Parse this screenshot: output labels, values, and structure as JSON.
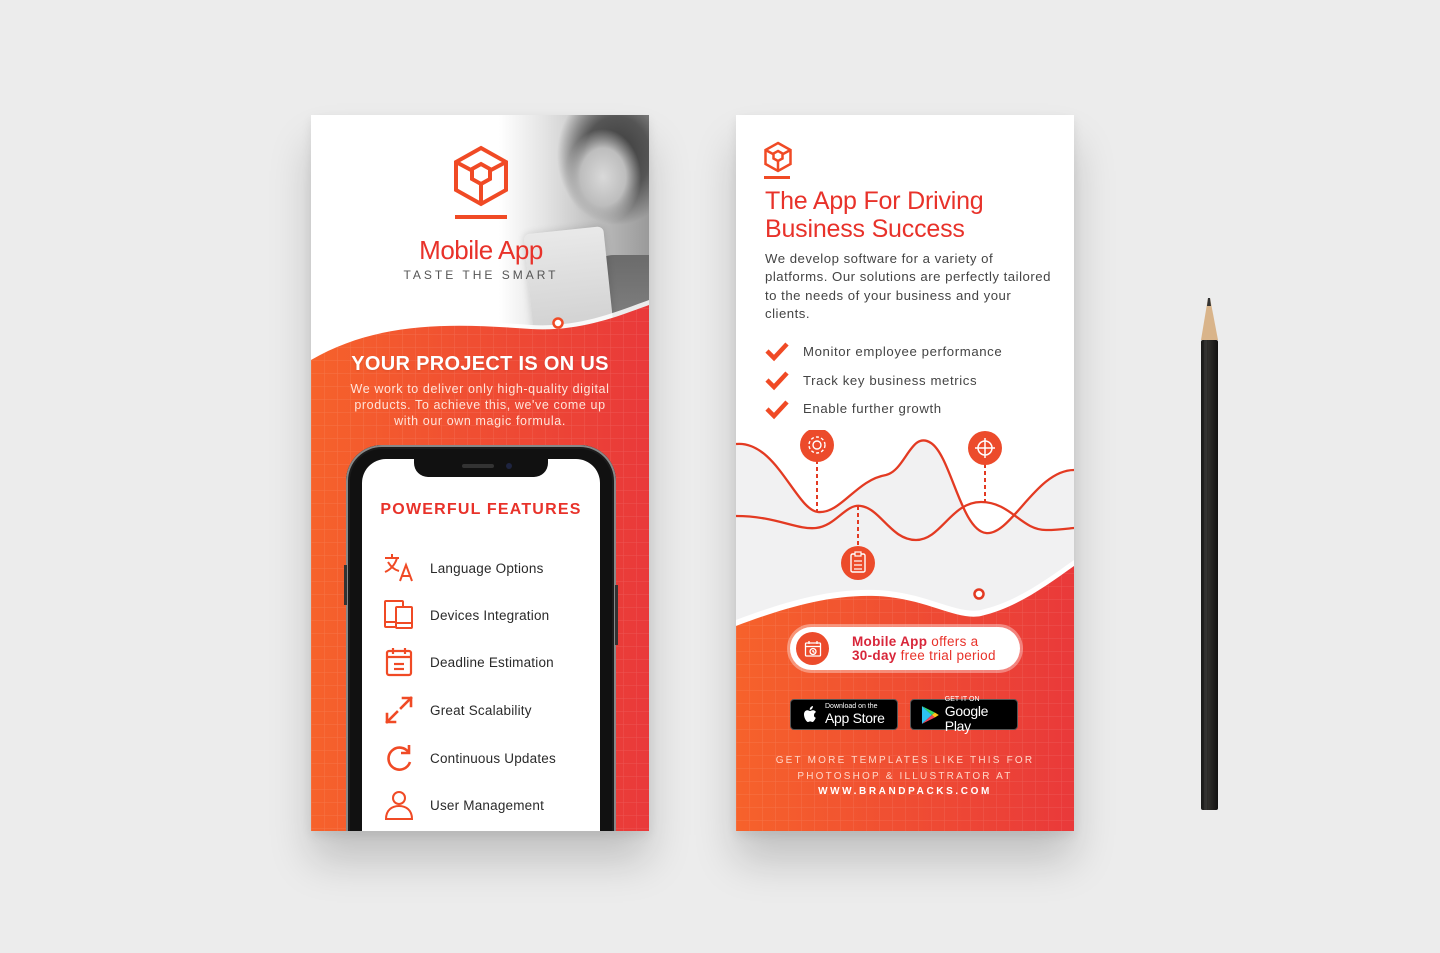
{
  "scene": {
    "background": "#ececec",
    "accent": "#f04a25",
    "accent_dark": "#e8322a",
    "gradient": [
      "#f5612a",
      "#e9393a"
    ]
  },
  "front_card": {
    "logo_icon": "hexagon-cube-logo",
    "brand_title": "Mobile App",
    "brand_tagline": "TASTE THE SMART",
    "photo": "smiling-woman-with-tablet-grayscale",
    "headline": "YOUR PROJECT IS ON US",
    "intro": "We work to deliver only high-quality digital products. To achieve this, we've come up with our own magic formula.",
    "phone": {
      "section_title": "POWERFUL FEATURES",
      "features": [
        {
          "icon": "translate-icon",
          "label": "Language Options"
        },
        {
          "icon": "devices-icon",
          "label": "Devices Integration"
        },
        {
          "icon": "calendar-icon",
          "label": "Deadline Estimation"
        },
        {
          "icon": "expand-arrows-icon",
          "label": "Great Scalability"
        },
        {
          "icon": "refresh-icon",
          "label": "Continuous Updates"
        },
        {
          "icon": "user-icon",
          "label": "User Management"
        }
      ]
    }
  },
  "back_card": {
    "logo_icon": "hexagon-cube-logo",
    "title_line1": "The App For Driving",
    "title_line2": "Business Success",
    "body": "We develop software for a variety of platforms. Our solutions are perfectly tailored to the needs of your business and your clients.",
    "checklist": [
      "Monitor employee performance",
      "Track key business metrics",
      "Enable further growth"
    ],
    "graph_markers": [
      "gear-icon",
      "clipboard-icon",
      "target-icon"
    ],
    "trial": {
      "icon": "calendar-clock-icon",
      "brand": "Mobile App",
      "text1": " offers a",
      "days": "30-day",
      "text2": " free trial period"
    },
    "app_store": {
      "small": "Download on the",
      "big": "App Store"
    },
    "google_play": {
      "small": "GET IT ON",
      "big": "Google Play"
    },
    "promo_line1": "GET MORE TEMPLATES LIKE THIS FOR",
    "promo_line2": "PHOTOSHOP & ILLUSTRATOR AT",
    "promo_url": "WWW.BRANDPACKS.COM"
  },
  "props": {
    "pencil": "black-pencil"
  }
}
